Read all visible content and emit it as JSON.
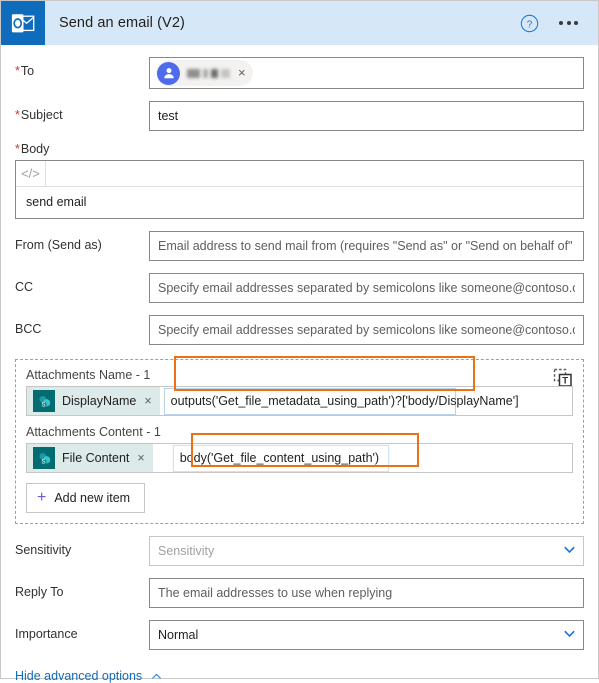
{
  "header": {
    "title": "Send an email (V2)",
    "app_icon": "outlook-icon",
    "help_icon": "help-circle-icon",
    "more_icon": "ellipsis-icon"
  },
  "fields": {
    "to": {
      "label": "To",
      "required": true,
      "chip": {
        "name_redacted": true,
        "remove_label": "×",
        "avatar_icon": "person-icon"
      }
    },
    "subject": {
      "label": "Subject",
      "required": true,
      "value": "test"
    },
    "body": {
      "label": "Body",
      "required": true,
      "toolbar_icon": "code-view-icon",
      "toolbar_glyph": "</>",
      "value": "send email"
    },
    "from": {
      "label": "From (Send as)",
      "required": false,
      "placeholder": "Email address to send mail from (requires \"Send as\" or \"Send on behalf of\" permissions)"
    },
    "cc": {
      "label": "CC",
      "required": false,
      "placeholder": "Specify email addresses separated by semicolons like someone@contoso.com"
    },
    "bcc": {
      "label": "BCC",
      "required": false,
      "placeholder": "Specify email addresses separated by semicolons like someone@contoso.com"
    },
    "sensitivity": {
      "label": "Sensitivity",
      "placeholder": "Sensitivity",
      "value": "",
      "chevron_icon": "chevron-down-icon"
    },
    "reply_to": {
      "label": "Reply To",
      "placeholder": "The email addresses to use when replying"
    },
    "importance": {
      "label": "Importance",
      "value": "Normal",
      "chevron_icon": "chevron-down-icon"
    }
  },
  "attachments": {
    "text_mode_icon": "text-mode-icon",
    "items": [
      {
        "label": "Attachments Name - 1",
        "token": {
          "text": "DisplayName",
          "icon": "sharepoint-icon",
          "remove_label": "×"
        },
        "expression": "outputs('Get_file_metadata_using_path')?['body/DisplayName']",
        "highlighted": true
      },
      {
        "label": "Attachments Content - 1",
        "token": {
          "text": "File Content",
          "icon": "sharepoint-icon",
          "remove_label": "×"
        },
        "expression": "body('Get_file_content_using_path')",
        "highlighted": true
      }
    ],
    "add_button": {
      "label": "Add new item",
      "icon": "plus-icon"
    }
  },
  "footer": {
    "hide_advanced_label": "Hide advanced options",
    "chevron_icon": "chevron-up-icon"
  },
  "colors": {
    "accent_blue": "#0f6cbd",
    "header_bg": "#d6e8f7",
    "highlight_orange": "#ec7014",
    "required_red": "#d13438",
    "sharepoint_teal": "#036c70",
    "token_bg": "#ddeaea"
  }
}
